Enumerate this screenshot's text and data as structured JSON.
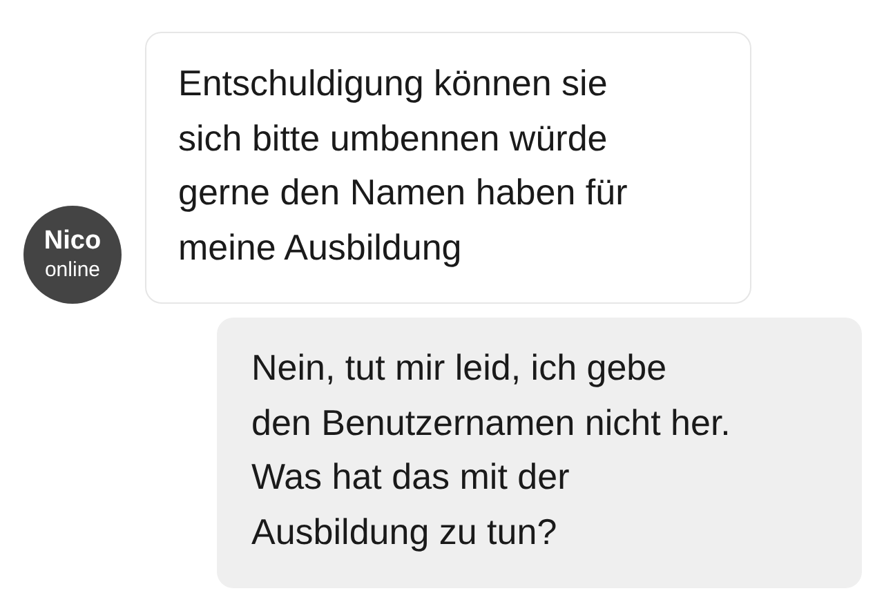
{
  "messages": [
    {
      "kind": "incoming",
      "sender": {
        "name": "Nico",
        "status": "online"
      },
      "lines": [
        "Entschuldigung können sie",
        "sich bitte umbennen würde",
        "gerne den Namen haben für",
        "meine Ausbildung"
      ]
    },
    {
      "kind": "outgoing",
      "lines": [
        "Nein, tut mir leid, ich gebe",
        "den Benutzernamen nicht her.",
        "Was hat das mit der",
        "Ausbildung zu tun?"
      ]
    }
  ]
}
